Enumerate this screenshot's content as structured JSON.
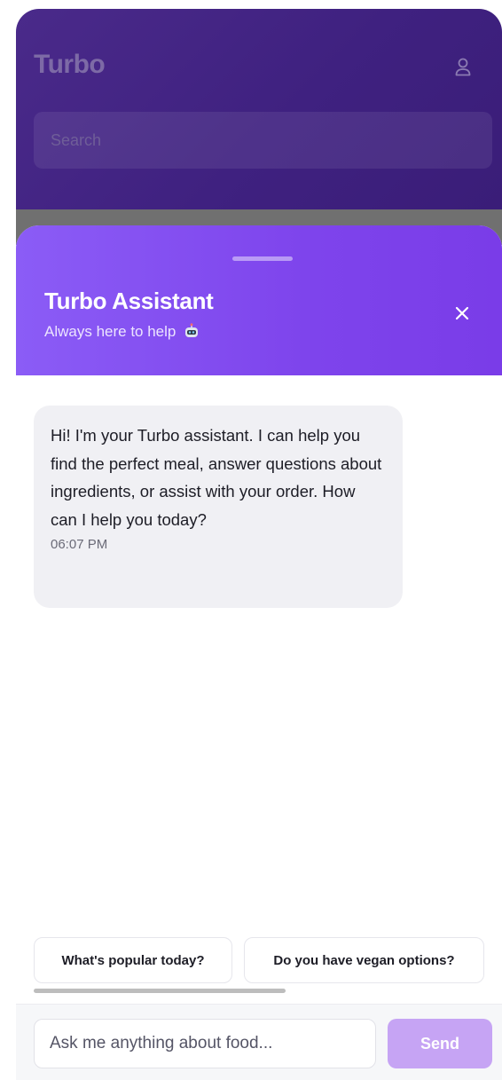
{
  "app": {
    "title": "Turbo",
    "search_placeholder": "Search",
    "user_icon": "user-icon"
  },
  "assistant": {
    "title": "Turbo Assistant",
    "subtitle": "Always here to help",
    "subtitle_icon": "robot-icon",
    "close_icon": "close-icon",
    "header_color": "#8b5cf6"
  },
  "messages": [
    {
      "text": "Hi! I'm your Turbo assistant. I can help you find the perfect meal, answer questions about ingredients, or assist with your order. How can I help you today?",
      "time": "06:07 PM",
      "sender": "assistant"
    }
  ],
  "suggestions": [
    {
      "label": "What's popular today?"
    },
    {
      "label": "Do you have vegan options?"
    }
  ],
  "composer": {
    "placeholder": "Ask me anything about food...",
    "send_label": "Send",
    "send_color": "#c6a4f4"
  }
}
